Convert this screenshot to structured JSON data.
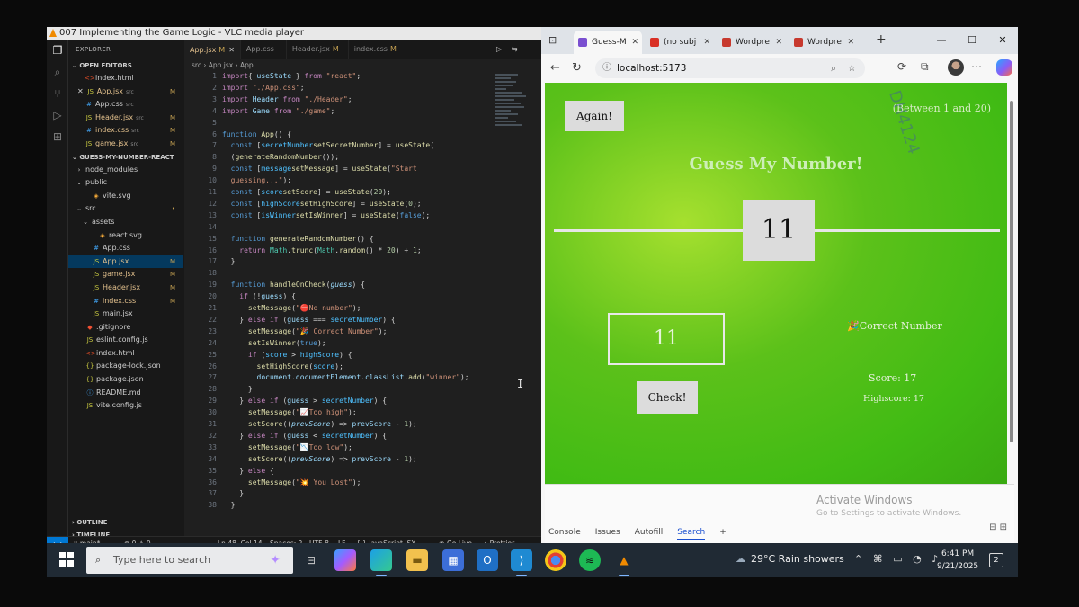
{
  "vlc": {
    "title": "007 Implementing the Game Logic - VLC media player"
  },
  "vscode": {
    "explorer_label": "EXPLORER",
    "open_editors_label": "OPEN EDITORS",
    "open_editors": [
      {
        "name": "index.html",
        "tag": "",
        "status": "",
        "icon": "html"
      },
      {
        "name": "App.jsx",
        "tag": "src",
        "status": "M",
        "icon": "js",
        "close": "✕"
      },
      {
        "name": "App.css",
        "tag": "src",
        "status": "",
        "icon": "css"
      },
      {
        "name": "Header.jsx",
        "tag": "src",
        "status": "M",
        "icon": "js"
      },
      {
        "name": "index.css",
        "tag": "src",
        "status": "M",
        "icon": "css"
      },
      {
        "name": "game.jsx",
        "tag": "src",
        "status": "M",
        "icon": "js"
      }
    ],
    "project_label": "GUESS-MY-NUMBER-REACT",
    "tree": [
      {
        "name": "node_modules",
        "indent": 1,
        "icon": "fold",
        "chev": "›",
        "status": ""
      },
      {
        "name": "public",
        "indent": 1,
        "icon": "fold",
        "chev": "⌄",
        "status": ""
      },
      {
        "name": "vite.svg",
        "indent": 2,
        "icon": "svg",
        "chev": "",
        "status": ""
      },
      {
        "name": "src",
        "indent": 1,
        "icon": "fold",
        "chev": "⌄",
        "status": "•"
      },
      {
        "name": "assets",
        "indent": 2,
        "icon": "fold",
        "chev": "⌄",
        "status": ""
      },
      {
        "name": "react.svg",
        "indent": 3,
        "icon": "svg",
        "chev": "",
        "status": ""
      },
      {
        "name": "App.css",
        "indent": 2,
        "icon": "css",
        "chev": "",
        "status": ""
      },
      {
        "name": "App.jsx",
        "indent": 2,
        "icon": "js",
        "chev": "",
        "status": "M"
      },
      {
        "name": "game.jsx",
        "indent": 2,
        "icon": "js",
        "chev": "",
        "status": "M"
      },
      {
        "name": "Header.jsx",
        "indent": 2,
        "icon": "js",
        "chev": "",
        "status": "M"
      },
      {
        "name": "index.css",
        "indent": 2,
        "icon": "css",
        "chev": "",
        "status": "M"
      },
      {
        "name": "main.jsx",
        "indent": 2,
        "icon": "js",
        "chev": "",
        "status": ""
      },
      {
        "name": ".gitignore",
        "indent": 1,
        "icon": "git",
        "chev": "",
        "status": ""
      },
      {
        "name": "eslint.config.js",
        "indent": 1,
        "icon": "js",
        "chev": "",
        "status": ""
      },
      {
        "name": "index.html",
        "indent": 1,
        "icon": "html",
        "chev": "",
        "status": ""
      },
      {
        "name": "package-lock.json",
        "indent": 1,
        "icon": "json",
        "chev": "",
        "status": ""
      },
      {
        "name": "package.json",
        "indent": 1,
        "icon": "json",
        "chev": "",
        "status": ""
      },
      {
        "name": "README.md",
        "indent": 1,
        "icon": "md",
        "chev": "",
        "status": ""
      },
      {
        "name": "vite.config.js",
        "indent": 1,
        "icon": "js",
        "chev": "",
        "status": ""
      }
    ],
    "outline_label": "OUTLINE",
    "timeline_label": "TIMELINE",
    "tabs": [
      {
        "name": "App.jsx",
        "mark": "M",
        "close": "✕"
      },
      {
        "name": "App.css",
        "mark": "",
        "close": ""
      },
      {
        "name": "Header.jsx",
        "mark": "M",
        "close": ""
      },
      {
        "name": "index.css",
        "mark": "M",
        "close": ""
      }
    ],
    "breadcrumb": "src  ›  App.jsx  ›  App",
    "start_line": 1,
    "code_lines": [
      [
        [
          "kw",
          "import"
        ],
        [
          "",
          "{ "
        ],
        [
          "vr",
          "useState"
        ],
        [
          "",
          " } "
        ],
        [
          "kw",
          "from"
        ],
        [
          "",
          " "
        ],
        [
          "st2",
          "\"react\""
        ],
        [
          "",
          ";"
        ]
      ],
      [
        [
          "kw",
          "import"
        ],
        [
          "",
          " "
        ],
        [
          "st2",
          "\"./App.css\""
        ],
        [
          "",
          ";"
        ]
      ],
      [
        [
          "kw",
          "import"
        ],
        [
          "",
          " "
        ],
        [
          "vr",
          "Header"
        ],
        [
          "",
          " "
        ],
        [
          "kw",
          "from"
        ],
        [
          "",
          " "
        ],
        [
          "st2",
          "\"./Header\""
        ],
        [
          "",
          ";"
        ]
      ],
      [
        [
          "kw",
          "import"
        ],
        [
          "",
          " "
        ],
        [
          "vr",
          "Game"
        ],
        [
          "",
          " "
        ],
        [
          "kw",
          "from"
        ],
        [
          "",
          " "
        ],
        [
          "st2",
          "\"./game\""
        ],
        [
          "",
          ";"
        ]
      ],
      [],
      [
        [
          "kb",
          "function"
        ],
        [
          "",
          " "
        ],
        [
          "fn",
          "App"
        ],
        [
          "",
          "() {"
        ]
      ],
      [
        [
          "",
          "  "
        ],
        [
          "kb",
          "const"
        ],
        [
          "",
          " ["
        ],
        [
          "cn",
          "secretNumber"
        ],
        [
          ", "
        ],
        [
          "fn",
          "setSecretNumber"
        ],
        [
          "",
          "] = "
        ],
        [
          "fn",
          "useState"
        ],
        [
          "",
          "("
        ]
      ],
      [
        [
          "",
          "  ("
        ],
        [
          "fn",
          "generateRandomNumber"
        ],
        [
          "",
          "());"
        ]
      ],
      [
        [
          "",
          "  "
        ],
        [
          "kb",
          "const"
        ],
        [
          "",
          " ["
        ],
        [
          "cn",
          "message"
        ],
        [
          ", "
        ],
        [
          "fn",
          "setMessage"
        ],
        [
          "",
          "] = "
        ],
        [
          "fn",
          "useState"
        ],
        [
          "",
          "("
        ],
        [
          "st2",
          "\"Start"
        ]
      ],
      [
        [
          "st2",
          "  guessing...\""
        ],
        [
          "",
          ");"
        ]
      ],
      [
        [
          "",
          "  "
        ],
        [
          "kb",
          "const"
        ],
        [
          "",
          " ["
        ],
        [
          "cn",
          "score"
        ],
        [
          ", "
        ],
        [
          "fn",
          "setScore"
        ],
        [
          "",
          "] = "
        ],
        [
          "fn",
          "useState"
        ],
        [
          "",
          "("
        ],
        [
          "nu",
          "20"
        ],
        [
          "",
          ");"
        ]
      ],
      [
        [
          "",
          "  "
        ],
        [
          "kb",
          "const"
        ],
        [
          "",
          " ["
        ],
        [
          "cn",
          "highScore"
        ],
        [
          ", "
        ],
        [
          "fn",
          "setHighScore"
        ],
        [
          "",
          "] = "
        ],
        [
          "fn",
          "useState"
        ],
        [
          "",
          "("
        ],
        [
          "nu",
          "0"
        ],
        [
          "",
          ");"
        ]
      ],
      [
        [
          "",
          "  "
        ],
        [
          "kb",
          "const"
        ],
        [
          "",
          " ["
        ],
        [
          "cn",
          "isWinner"
        ],
        [
          ", "
        ],
        [
          "fn",
          "setIsWinner"
        ],
        [
          "",
          "] = "
        ],
        [
          "fn",
          "useState"
        ],
        [
          "",
          "("
        ],
        [
          "kb",
          "false"
        ],
        [
          "",
          ");"
        ]
      ],
      [],
      [
        [
          "",
          "  "
        ],
        [
          "kb",
          "function"
        ],
        [
          "",
          " "
        ],
        [
          "fn",
          "generateRandomNumber"
        ],
        [
          "",
          "() {"
        ]
      ],
      [
        [
          "",
          "    "
        ],
        [
          "kw",
          "return"
        ],
        [
          "",
          " "
        ],
        [
          "ty",
          "Math"
        ],
        [
          "",
          "."
        ],
        [
          "fn",
          "trunc"
        ],
        [
          "",
          "("
        ],
        [
          "ty",
          "Math"
        ],
        [
          "",
          "."
        ],
        [
          "fn",
          "random"
        ],
        [
          "",
          "() * "
        ],
        [
          "nu",
          "20"
        ],
        [
          "",
          ") + "
        ],
        [
          "nu",
          "1"
        ],
        [
          "",
          ";"
        ]
      ],
      [
        [
          "",
          "  }"
        ]
      ],
      [],
      [
        [
          "",
          "  "
        ],
        [
          "kb",
          "function"
        ],
        [
          "",
          " "
        ],
        [
          "fn",
          "handleOnCheck"
        ],
        [
          "",
          "("
        ],
        [
          "pm",
          "guess"
        ],
        [
          "",
          ") {"
        ]
      ],
      [
        [
          "",
          "    "
        ],
        [
          "kw",
          "if"
        ],
        [
          "",
          " (!"
        ],
        [
          "vr",
          "guess"
        ],
        [
          "",
          ") {"
        ]
      ],
      [
        [
          "",
          "      "
        ],
        [
          "fn",
          "setMessage"
        ],
        [
          "",
          "("
        ],
        [
          "st2",
          "\"⛔No number\""
        ],
        [
          "",
          ");"
        ]
      ],
      [
        [
          "",
          "    } "
        ],
        [
          "kw",
          "else if"
        ],
        [
          "",
          " ("
        ],
        [
          "vr",
          "guess"
        ],
        [
          "",
          " === "
        ],
        [
          "cn",
          "secretNumber"
        ],
        [
          "",
          ") {"
        ]
      ],
      [
        [
          "",
          "      "
        ],
        [
          "fn",
          "setMessage"
        ],
        [
          "",
          "("
        ],
        [
          "st2",
          "\"🎉 Correct Number\""
        ],
        [
          "",
          ");"
        ]
      ],
      [
        [
          "",
          "      "
        ],
        [
          "fn",
          "setIsWinner"
        ],
        [
          "",
          "("
        ],
        [
          "kb",
          "true"
        ],
        [
          "",
          ");"
        ]
      ],
      [
        [
          "",
          "      "
        ],
        [
          "kw",
          "if"
        ],
        [
          "",
          " ("
        ],
        [
          "cn",
          "score"
        ],
        [
          "",
          " > "
        ],
        [
          "cn",
          "highScore"
        ],
        [
          "",
          ") {"
        ]
      ],
      [
        [
          "",
          "        "
        ],
        [
          "fn",
          "setHighScore"
        ],
        [
          "",
          "("
        ],
        [
          "cn",
          "score"
        ],
        [
          "",
          ");"
        ]
      ],
      [
        [
          "",
          "        "
        ],
        [
          "vr",
          "document"
        ],
        [
          "",
          "."
        ],
        [
          "vr",
          "documentElement"
        ],
        [
          "",
          "."
        ],
        [
          "vr",
          "classList"
        ],
        [
          "",
          "."
        ],
        [
          "fn",
          "add"
        ],
        [
          "",
          "("
        ],
        [
          "st2",
          "\"winner\""
        ],
        [
          "",
          ");"
        ]
      ],
      [
        [
          "",
          "      }"
        ]
      ],
      [
        [
          "",
          "    } "
        ],
        [
          "kw",
          "else if"
        ],
        [
          "",
          " ("
        ],
        [
          "vr",
          "guess"
        ],
        [
          "",
          " > "
        ],
        [
          "cn",
          "secretNumber"
        ],
        [
          "",
          ") {"
        ]
      ],
      [
        [
          "",
          "      "
        ],
        [
          "fn",
          "setMessage"
        ],
        [
          "",
          "("
        ],
        [
          "st2",
          "\"📈Too high\""
        ],
        [
          "",
          ");"
        ]
      ],
      [
        [
          "",
          "      "
        ],
        [
          "fn",
          "setScore"
        ],
        [
          "",
          "(("
        ],
        [
          "pm",
          "prevScore"
        ],
        [
          "",
          ") => "
        ],
        [
          "vr",
          "prevScore"
        ],
        [
          "",
          " - "
        ],
        [
          "nu",
          "1"
        ],
        [
          "",
          ");"
        ]
      ],
      [
        [
          "",
          "    } "
        ],
        [
          "kw",
          "else if"
        ],
        [
          "",
          " ("
        ],
        [
          "vr",
          "guess"
        ],
        [
          "",
          " < "
        ],
        [
          "cn",
          "secretNumber"
        ],
        [
          "",
          ") {"
        ]
      ],
      [
        [
          "",
          "      "
        ],
        [
          "fn",
          "setMessage"
        ],
        [
          "",
          "("
        ],
        [
          "st2",
          "\"📉Too low\""
        ],
        [
          "",
          ");"
        ]
      ],
      [
        [
          "",
          "      "
        ],
        [
          "fn",
          "setScore"
        ],
        [
          "",
          "(("
        ],
        [
          "pm",
          "prevScore"
        ],
        [
          "",
          ") => "
        ],
        [
          "vr",
          "prevScore"
        ],
        [
          "",
          " - "
        ],
        [
          "nu",
          "1"
        ],
        [
          "",
          ");"
        ]
      ],
      [
        [
          "",
          "    } "
        ],
        [
          "kw",
          "else"
        ],
        [
          "",
          " {"
        ]
      ],
      [
        [
          "",
          "      "
        ],
        [
          "fn",
          "setMessage"
        ],
        [
          "",
          "("
        ],
        [
          "st2",
          "\"💥 You Lost\""
        ],
        [
          "",
          ");"
        ]
      ],
      [
        [
          "",
          "    }"
        ]
      ],
      [
        [
          "",
          "  }"
        ]
      ]
    ],
    "status": {
      "branch": "main*",
      "problems": "⊗ 0  ⚠ 0",
      "position": "Ln 48, Col 14",
      "spaces": "Spaces: 2",
      "encoding": "UTF-8",
      "eol": "LF",
      "language": "{ } JavaScript JSX",
      "golive": "Go Live",
      "prettier": "✓ Prettier"
    }
  },
  "browser": {
    "tabs": [
      {
        "label": "Guess-M",
        "color": "#7a4fd0",
        "active": true,
        "close": "✕"
      },
      {
        "label": "(no subj",
        "color": "#d93025",
        "active": false,
        "close": "✕"
      },
      {
        "label": "Wordpre",
        "color": "#c7392e",
        "active": false,
        "close": "✕"
      },
      {
        "label": "Wordpre",
        "color": "#c7392e",
        "active": false,
        "close": "✕"
      }
    ],
    "new_tab": "+",
    "url": "localhost:5173",
    "devtools_tabs": [
      "Console",
      "Issues",
      "Autofill",
      "Search"
    ],
    "devtools_active": "Search",
    "activate_title": "Activate Windows",
    "activate_sub": "Go to Settings to activate Windows."
  },
  "game": {
    "again_label": "Again!",
    "range_text": "(Between 1 and 20)",
    "title": "Guess My Number!",
    "secret_display": "11",
    "guess_value": "11",
    "check_label": "Check!",
    "message": "🎉Correct Number",
    "score_text": "Score: 17",
    "highscore_text": "Highscore: 17",
    "watermark": "DH4124"
  },
  "taskbar": {
    "search_placeholder": "Type here to search",
    "weather": "29°C  Rain showers",
    "time": "6:41 PM",
    "date": "9/21/2025",
    "notifications": "2"
  }
}
